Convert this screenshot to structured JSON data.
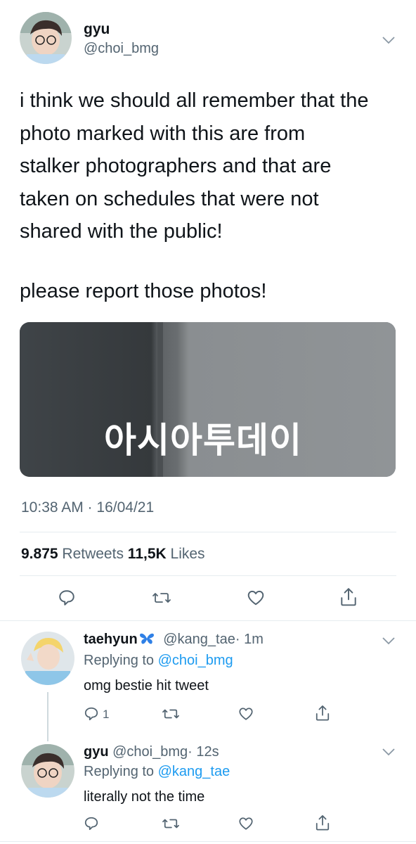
{
  "main_tweet": {
    "display_name": "gyu",
    "handle": "@choi_bmg",
    "lines": [
      "i think we should all remember that the",
      "photo marked with this are from",
      "stalker photographers and that are",
      "taken on schedules that were not",
      "shared with the public!"
    ],
    "line2": "please report those photos!",
    "media_watermark": "아시아투데이",
    "timestamp": "10:38 AM · 16/04/21",
    "retweets_count": "9.875",
    "retweets_label": "Retweets",
    "likes_count": "11,5K",
    "likes_label": "Likes"
  },
  "replies": [
    {
      "display_name": "taehyun",
      "handle": "@kang_tae",
      "time": "· 1m",
      "replying_label": "Replying to",
      "replying_handle": "@choi_bmg",
      "text": "omg bestie hit tweet",
      "reply_count": "1"
    },
    {
      "display_name": "gyu",
      "handle": "@choi_bmg",
      "time": "· 12s",
      "replying_label": "Replying to",
      "replying_handle": "@kang_tae",
      "text": "literally not the time",
      "reply_count": ""
    }
  ],
  "colors": {
    "accent": "#1d9bf0",
    "muted": "#536471",
    "text": "#0f1419",
    "divider": "#e6ecf0"
  },
  "icons": [
    "chevron-down-icon",
    "reply-icon",
    "retweet-icon",
    "like-icon",
    "share-icon",
    "butterfly-icon"
  ]
}
